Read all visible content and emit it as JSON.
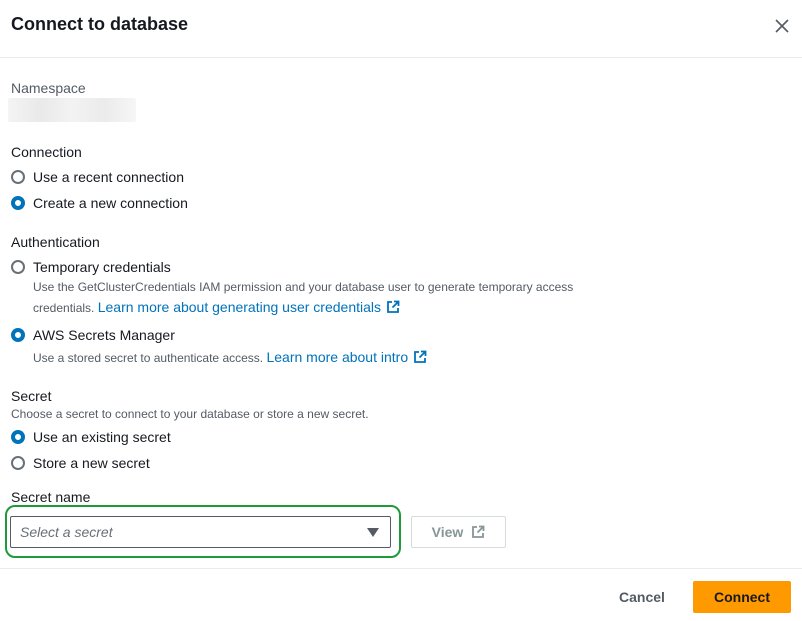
{
  "modal": {
    "title": "Connect to database",
    "close_icon": "close-icon"
  },
  "namespace": {
    "label": "Namespace"
  },
  "connection": {
    "label": "Connection",
    "options": [
      {
        "label": "Use a recent connection",
        "checked": false
      },
      {
        "label": "Create a new connection",
        "checked": true
      }
    ]
  },
  "authentication": {
    "label": "Authentication",
    "options": [
      {
        "label": "Temporary credentials",
        "checked": false,
        "description": "Use the GetClusterCredentials IAM permission and your database user to generate temporary access credentials.",
        "link": "Learn more about generating user credentials",
        "link_icon": "external-link-icon"
      },
      {
        "label": "AWS Secrets Manager",
        "checked": true,
        "description": "Use a stored secret to authenticate access.",
        "link": "Learn more about intro",
        "link_icon": "external-link-icon"
      }
    ]
  },
  "secret": {
    "label": "Secret",
    "description": "Choose a secret to connect to your database or store a new secret.",
    "options": [
      {
        "label": "Use an existing secret",
        "checked": true
      },
      {
        "label": "Store a new secret",
        "checked": false
      }
    ]
  },
  "secret_name": {
    "label": "Secret name",
    "placeholder": "Select a secret",
    "caret_icon": "caret-down-icon",
    "highlight_color": "#1d9a3a"
  },
  "view_button": {
    "label": "View",
    "icon": "external-link-icon"
  },
  "footer": {
    "cancel_label": "Cancel",
    "connect_label": "Connect",
    "connect_color": "#ff9900"
  }
}
